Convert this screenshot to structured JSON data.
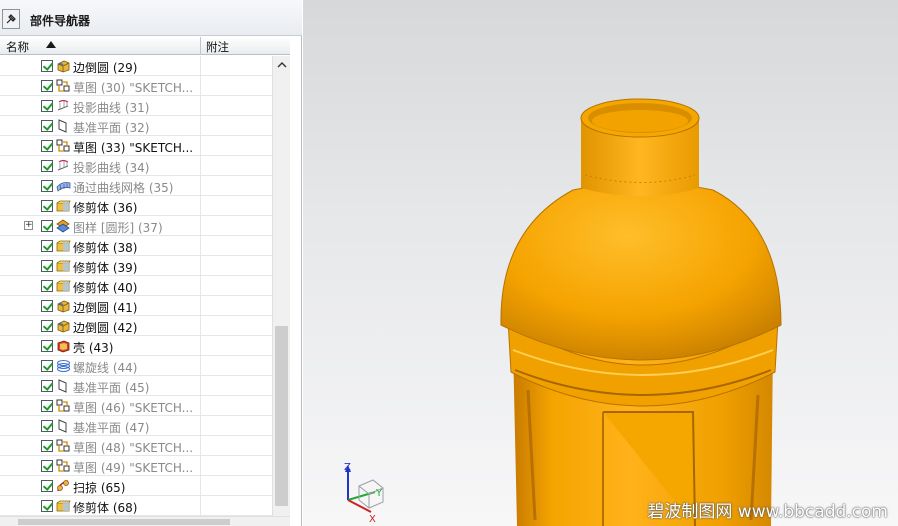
{
  "navigator": {
    "title": "部件导航器",
    "pin_icon": "pin-icon"
  },
  "columns": {
    "name": "名称",
    "note": "附注"
  },
  "features": [
    {
      "icon": "blend-icon",
      "label": "边倒圆 (29)",
      "dim": false,
      "expandable": false
    },
    {
      "icon": "sketch-icon",
      "label": "草图 (30) \"SKETCH...",
      "dim": true,
      "expandable": false
    },
    {
      "icon": "projected-curve-icon",
      "label": "投影曲线 (31)",
      "dim": true,
      "expandable": false
    },
    {
      "icon": "datum-plane-icon",
      "label": "基准平面 (32)",
      "dim": true,
      "expandable": false
    },
    {
      "icon": "sketch-icon",
      "label": "草图 (33) \"SKETCH...",
      "dim": false,
      "expandable": false
    },
    {
      "icon": "projected-curve-icon",
      "label": "投影曲线 (34)",
      "dim": true,
      "expandable": false
    },
    {
      "icon": "through-curve-mesh-icon",
      "label": "通过曲线网格 (35)",
      "dim": true,
      "expandable": false
    },
    {
      "icon": "trim-body-icon",
      "label": "修剪体 (36)",
      "dim": false,
      "expandable": false
    },
    {
      "icon": "pattern-icon",
      "label": "图样 [圆形] (37)",
      "dim": true,
      "expandable": true
    },
    {
      "icon": "trim-body-icon",
      "label": "修剪体 (38)",
      "dim": false,
      "expandable": false
    },
    {
      "icon": "trim-body-icon",
      "label": "修剪体 (39)",
      "dim": false,
      "expandable": false
    },
    {
      "icon": "trim-body-icon",
      "label": "修剪体 (40)",
      "dim": false,
      "expandable": false
    },
    {
      "icon": "blend-icon",
      "label": "边倒圆 (41)",
      "dim": false,
      "expandable": false
    },
    {
      "icon": "blend-icon",
      "label": "边倒圆 (42)",
      "dim": false,
      "expandable": false
    },
    {
      "icon": "shell-icon",
      "label": "壳 (43)",
      "dim": false,
      "expandable": false
    },
    {
      "icon": "helix-icon",
      "label": "螺旋线 (44)",
      "dim": true,
      "expandable": false
    },
    {
      "icon": "datum-plane-icon",
      "label": "基准平面 (45)",
      "dim": true,
      "expandable": false
    },
    {
      "icon": "sketch-icon",
      "label": "草图 (46) \"SKETCH...",
      "dim": true,
      "expandable": false
    },
    {
      "icon": "datum-plane-icon",
      "label": "基准平面 (47)",
      "dim": true,
      "expandable": false
    },
    {
      "icon": "sketch-icon",
      "label": "草图 (48) \"SKETCH...",
      "dim": true,
      "expandable": false
    },
    {
      "icon": "sketch-icon",
      "label": "草图 (49) \"SKETCH...",
      "dim": true,
      "expandable": false
    },
    {
      "icon": "sweep-icon",
      "label": "扫掠 (65)",
      "dim": false,
      "expandable": false
    },
    {
      "icon": "trim-body-icon",
      "label": "修剪体 (68)",
      "dim": false,
      "expandable": false
    }
  ],
  "viewport": {
    "triad_labels": {
      "z": "Z",
      "y": "Y",
      "x": "X"
    },
    "model_color": "#f2a000",
    "watermark": "碧波制图网 www.bbcadd.com"
  },
  "colors": {
    "check_green": "#1f9a2a",
    "dim_text": "#8a8a8a"
  }
}
